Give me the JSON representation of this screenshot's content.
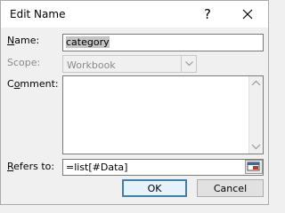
{
  "dialog": {
    "title": "Edit Name",
    "help_glyph": "?",
    "close_icon": "close-icon"
  },
  "name_field": {
    "label_access": "N",
    "label_rest": "ame:",
    "value": "category"
  },
  "scope_field": {
    "label": "Scope:",
    "value": "Workbook",
    "arrow_icon": "chevron-down-icon"
  },
  "comment_field": {
    "label_first": "C",
    "label_access": "o",
    "label_rest": "mment:",
    "value": ""
  },
  "refers_to_field": {
    "label_access": "R",
    "label_rest": "efers to:",
    "value": "=list[#Data]",
    "ref_icon": "collapse-dialog-icon"
  },
  "buttons": {
    "ok": "OK",
    "cancel": "Cancel"
  },
  "colors": {
    "accent": "#3c7fb1",
    "title_bg": "#ffffff",
    "dialog_bg": "#f0f0f0"
  }
}
